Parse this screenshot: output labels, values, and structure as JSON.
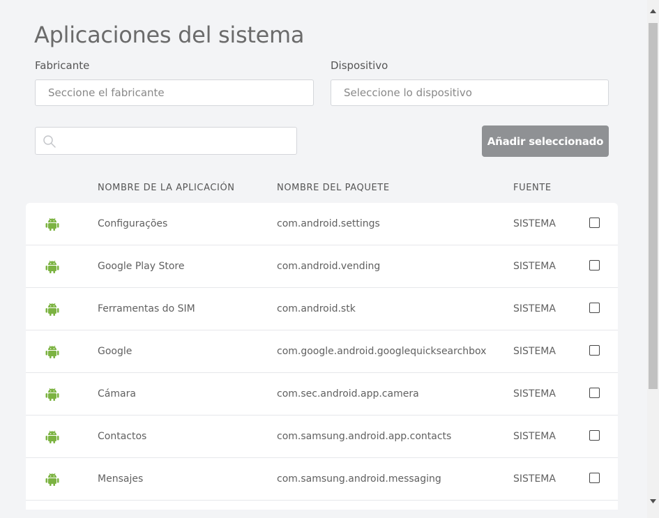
{
  "page": {
    "title": "Aplicaciones del sistema"
  },
  "filters": {
    "manufacturer_label": "Fabricante",
    "manufacturer_placeholder": "Seccione el fabricante",
    "device_label": "Dispositivo",
    "device_placeholder": "Seleccione lo dispositivo"
  },
  "search": {
    "placeholder": "",
    "icon": "search-icon"
  },
  "actions": {
    "add_selected_label": "Añadir seleccionado"
  },
  "table": {
    "columns": [
      "NOMBRE DE LA APLICACIÓN",
      "NOMBRE DEL PAQUETE",
      "FUENTE"
    ],
    "rows": [
      {
        "name": "Configurações",
        "package": "com.android.settings",
        "source": "SISTEMA",
        "checked": false
      },
      {
        "name": "Google Play Store",
        "package": "com.android.vending",
        "source": "SISTEMA",
        "checked": false
      },
      {
        "name": "Ferramentas do SIM",
        "package": "com.android.stk",
        "source": "SISTEMA",
        "checked": false
      },
      {
        "name": "Google",
        "package": "com.google.android.googlequicksearchbox",
        "source": "SISTEMA",
        "checked": false
      },
      {
        "name": "Cámara",
        "package": "com.sec.android.app.camera",
        "source": "SISTEMA",
        "checked": false
      },
      {
        "name": "Contactos",
        "package": "com.samsung.android.app.contacts",
        "source": "SISTEMA",
        "checked": false
      },
      {
        "name": "Mensajes",
        "package": "com.samsung.android.messaging",
        "source": "SISTEMA",
        "checked": false
      }
    ]
  },
  "colors": {
    "android_icon": "#7cb342",
    "button_bg": "#8f9194",
    "page_bg": "#f3f4f6"
  }
}
